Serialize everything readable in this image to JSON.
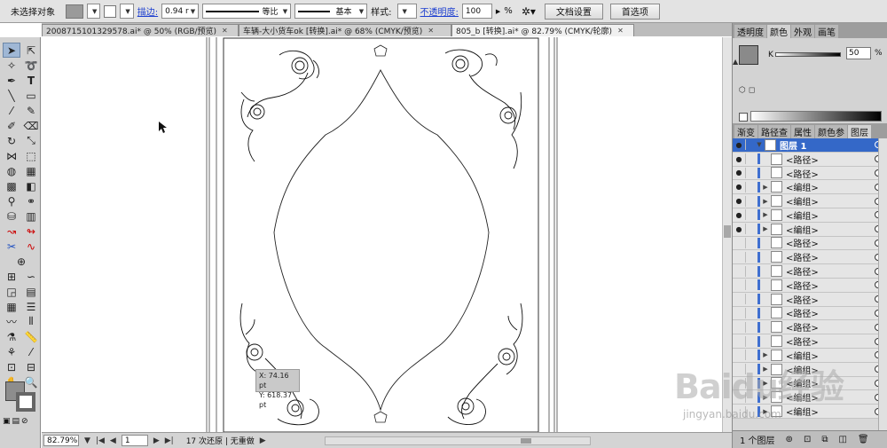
{
  "app": {
    "accent": "#3468c8"
  },
  "control_bar": {
    "selection_label": "未选择对象",
    "fill_color": "#9a9a9a",
    "stroke_label": "描边:",
    "stroke_weight": "0.94 r",
    "profile_label": "等比",
    "brush_label": "基本",
    "style_label": "样式:",
    "opacity_label": "不透明度:",
    "opacity_value": "100",
    "opacity_unit": "%",
    "doc_setup_button": "文档设置",
    "preferences_button": "首选项"
  },
  "tabs": [
    {
      "label": "20087151013295​78.ai* @ 50% (RGB/预览)"
    },
    {
      "label": "车辆-大小货车ok [转换].ai* @ 68% (CMYK/预览)"
    },
    {
      "label": "805_b [转换].ai* @ 82.79% (CMYK/轮廓)"
    }
  ],
  "tooltip": {
    "x": "X: 74.16 pt",
    "y": "Y: 618.37 pt"
  },
  "status_bar": {
    "zoom": "82.79%",
    "page": "1",
    "undo_info": "17 次还原 | 无重做"
  },
  "color_panel": {
    "tabs": [
      "透明度",
      "颜色",
      "外观",
      "画笔"
    ],
    "active_tab": "颜色",
    "channel": "K",
    "value": "50",
    "unit": "%"
  },
  "layers_panel": {
    "tabs": [
      "渐变",
      "路径查",
      "属性",
      "颜色参",
      "图层"
    ],
    "active_tab": "图层",
    "top_layer": "图层 1",
    "rows": [
      {
        "name": "<路径>",
        "eye": true,
        "expand": false
      },
      {
        "name": "<路径>",
        "eye": true,
        "expand": false
      },
      {
        "name": "<编组>",
        "eye": true,
        "expand": true
      },
      {
        "name": "<编组>",
        "eye": true,
        "expand": true
      },
      {
        "name": "<编组>",
        "eye": true,
        "expand": true
      },
      {
        "name": "<编组>",
        "eye": true,
        "expand": true
      },
      {
        "name": "<路径>",
        "eye": false,
        "expand": false
      },
      {
        "name": "<路径>",
        "eye": false,
        "expand": false
      },
      {
        "name": "<路径>",
        "eye": false,
        "expand": false
      },
      {
        "name": "<路径>",
        "eye": false,
        "expand": false
      },
      {
        "name": "<路径>",
        "eye": false,
        "expand": false
      },
      {
        "name": "<路径>",
        "eye": false,
        "expand": false
      },
      {
        "name": "<路径>",
        "eye": false,
        "expand": false
      },
      {
        "name": "<路径>",
        "eye": false,
        "expand": false
      },
      {
        "name": "<编组>",
        "eye": false,
        "expand": true
      },
      {
        "name": "<编组>",
        "eye": false,
        "expand": true
      },
      {
        "name": "<编组>",
        "eye": false,
        "expand": true
      },
      {
        "name": "<编组>",
        "eye": false,
        "expand": true
      },
      {
        "name": "<编组>",
        "eye": false,
        "expand": true
      }
    ],
    "footer_label": "1 个图层"
  },
  "watermark": {
    "main": "Baidu经验",
    "sub": "jingyan.baidu.com"
  }
}
